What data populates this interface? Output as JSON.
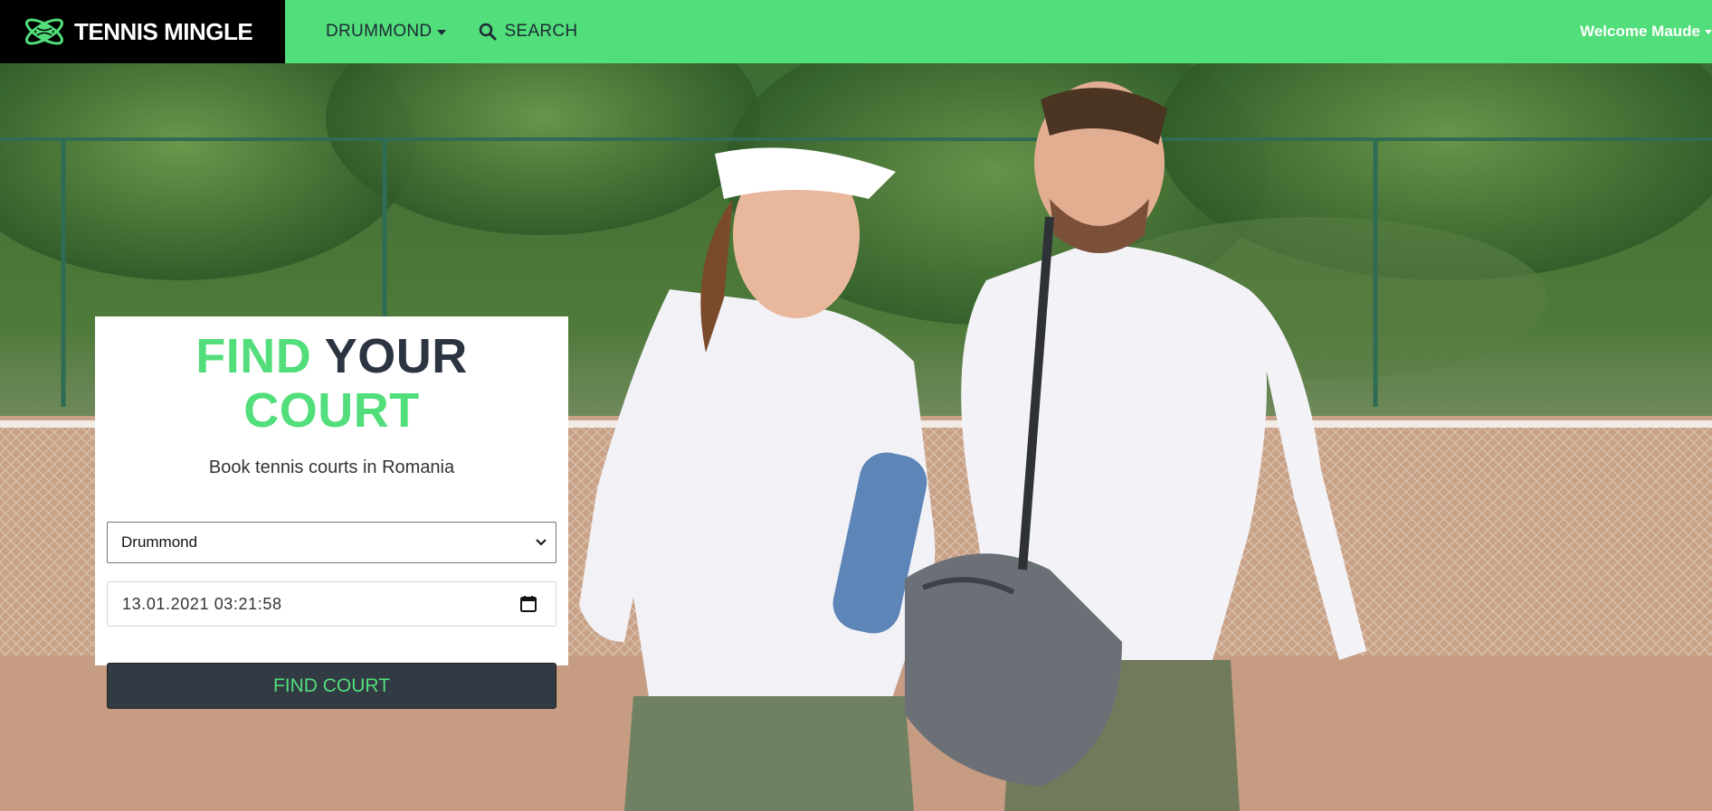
{
  "brand": {
    "name": "TENNIS MINGLE",
    "logo_icon": "tennis-ball-atom-icon"
  },
  "nav": {
    "location_label": "DRUMMOND",
    "search_label": "SEARCH",
    "welcome_label": "Welcome Maude"
  },
  "hero": {
    "image": "couple-walking-on-clay-tennis-court"
  },
  "search_card": {
    "title_part1": "FIND",
    "title_part2": "YOUR",
    "title_part3": "COURT",
    "subtitle": "Book tennis courts in Romania",
    "location_select": {
      "selected": "Drummond"
    },
    "datetime_input": {
      "value": "13.01.2021 03:21:58"
    },
    "submit_label": "FIND COURT"
  },
  "colors": {
    "accent": "#52de7a",
    "dark": "#2b3440",
    "button_bg": "#323a44",
    "brand_bg": "#000000"
  }
}
